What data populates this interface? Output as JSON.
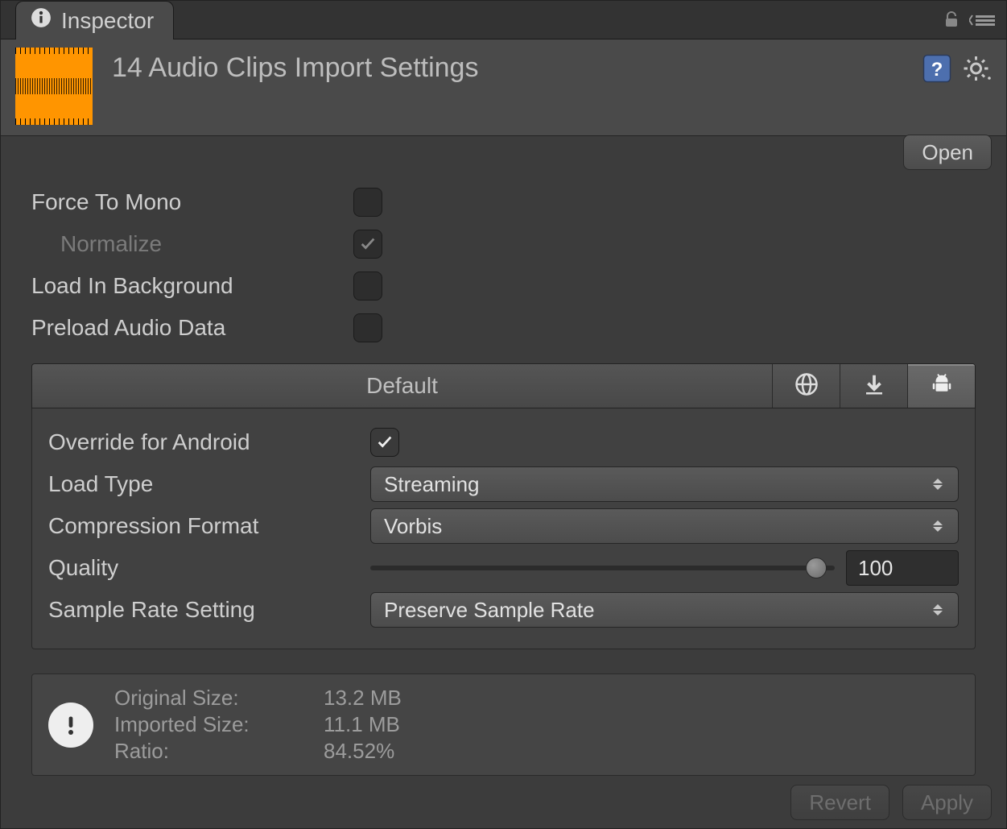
{
  "tab": {
    "title": "Inspector"
  },
  "header": {
    "title": "14 Audio Clips Import Settings",
    "open_button": "Open"
  },
  "settings": {
    "force_to_mono": {
      "label": "Force To Mono",
      "checked": false
    },
    "normalize": {
      "label": "Normalize",
      "checked": true,
      "disabled": true
    },
    "load_in_background": {
      "label": "Load In Background",
      "checked": false
    },
    "preload_audio": {
      "label": "Preload Audio Data",
      "checked": false
    }
  },
  "platform": {
    "tabs": {
      "default": "Default",
      "active_index": 3
    },
    "override": {
      "label": "Override for Android",
      "checked": true
    },
    "load_type": {
      "label": "Load Type",
      "value": "Streaming"
    },
    "compression": {
      "label": "Compression Format",
      "value": "Vorbis"
    },
    "quality": {
      "label": "Quality",
      "value": "100",
      "slider_pct": 96
    },
    "sample_rate": {
      "label": "Sample Rate Setting",
      "value": "Preserve Sample Rate"
    }
  },
  "info": {
    "original_label": "Original Size:",
    "original_value": "13.2 MB",
    "imported_label": "Imported Size:",
    "imported_value": "11.1 MB",
    "ratio_label": "Ratio:",
    "ratio_value": "84.52%"
  },
  "footer": {
    "revert": "Revert",
    "apply": "Apply"
  }
}
